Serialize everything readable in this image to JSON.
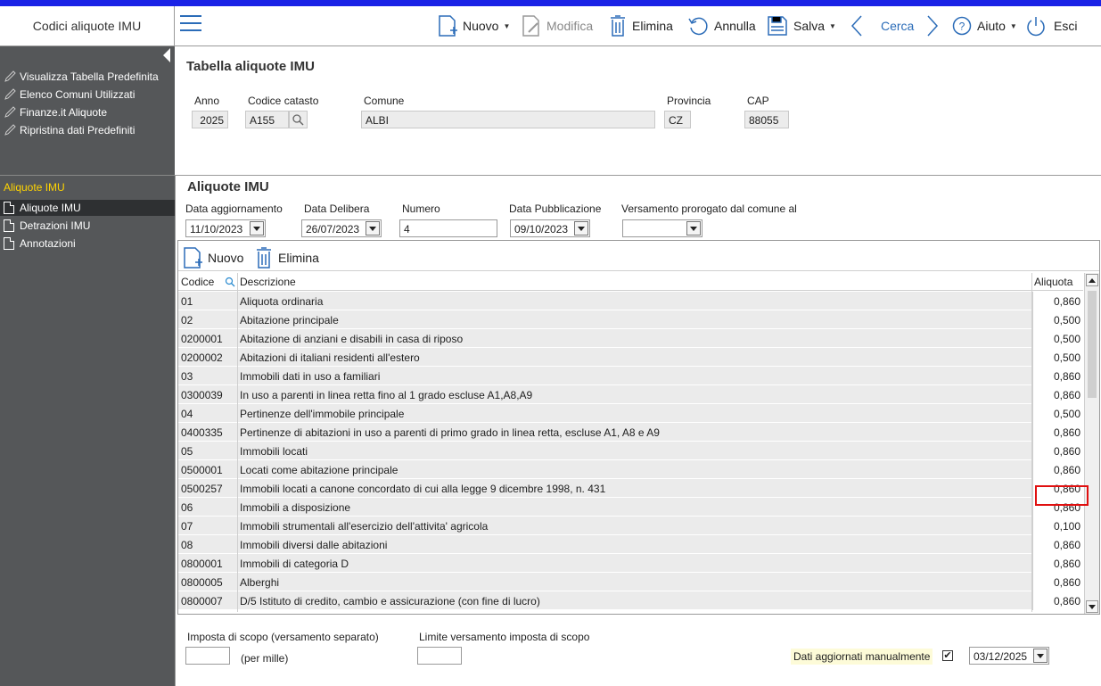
{
  "app": {
    "title": "Codici aliquote IMU"
  },
  "toolbar": {
    "nuovo": "Nuovo",
    "modifica": "Modifica",
    "elimina": "Elimina",
    "annulla": "Annulla",
    "salva": "Salva",
    "cerca": "Cerca",
    "aiuto": "Aiuto",
    "esci": "Esci"
  },
  "sidebar": {
    "links": [
      "Visualizza Tabella Predefinita",
      "Elenco Comuni Utilizzati",
      "Finanze.it Aliquote",
      "Ripristina dati Predefiniti"
    ],
    "section": "Aliquote IMU",
    "items": [
      "Aliquote IMU",
      "Detrazioni IMU",
      "Annotazioni"
    ]
  },
  "header": {
    "title": "Tabella aliquote IMU",
    "anno_label": "Anno",
    "anno": "2025",
    "catasto_label": "Codice catasto",
    "catasto": "A155",
    "comune_label": "Comune",
    "comune": "ALBI",
    "provincia_label": "Provincia",
    "provincia": "CZ",
    "cap_label": "CAP",
    "cap": "88055"
  },
  "aliquote": {
    "title": "Aliquote IMU",
    "data_agg_label": "Data aggiornamento",
    "data_agg": "11/10/2023",
    "data_del_label": "Data Delibera",
    "data_del": "26/07/2023",
    "numero_label": "Numero",
    "numero": "4",
    "data_pub_label": "Data Pubblicazione",
    "data_pub": "09/10/2023",
    "vers_label": "Versamento prorogato dal comune al",
    "vers": ""
  },
  "grid": {
    "nuovo": "Nuovo",
    "elimina": "Elimina",
    "col_codice": "Codice",
    "col_descr": "Descrizione",
    "col_aliquota": "Aliquota",
    "rows": [
      {
        "codice": "01",
        "descr": "Aliquota ordinaria",
        "val": "0,860"
      },
      {
        "codice": "02",
        "descr": "Abitazione principale",
        "val": "0,500"
      },
      {
        "codice": "0200001",
        "descr": "Abitazione di anziani e disabili in casa di riposo",
        "val": "0,500"
      },
      {
        "codice": "0200002",
        "descr": "Abitazioni di italiani residenti all'estero",
        "val": "0,500"
      },
      {
        "codice": "03",
        "descr": "Immobili dati in uso a familiari",
        "val": "0,860"
      },
      {
        "codice": "0300039",
        "descr": "In uso a parenti in linea retta fino al 1 grado escluse A1,A8,A9",
        "val": "0,860"
      },
      {
        "codice": "04",
        "descr": "Pertinenze dell'immobile principale",
        "val": "0,500"
      },
      {
        "codice": "0400335",
        "descr": "Pertinenze di abitazioni in uso a parenti di primo grado in linea retta, escluse A1, A8 e A9",
        "val": "0,860"
      },
      {
        "codice": "05",
        "descr": "Immobili locati",
        "val": "0,860"
      },
      {
        "codice": "0500001",
        "descr": "Locati come abitazione principale",
        "val": "0,860"
      },
      {
        "codice": "0500257",
        "descr": "Immobili locati a canone concordato di cui alla legge 9 dicembre 1998, n. 431",
        "val": "0,860"
      },
      {
        "codice": "06",
        "descr": "Immobili a disposizione",
        "val": "0,860"
      },
      {
        "codice": "07",
        "descr": "Immobili strumentali all'esercizio dell'attivita' agricola",
        "val": "0,100"
      },
      {
        "codice": "08",
        "descr": "Immobili diversi dalle abitazioni",
        "val": "0,860"
      },
      {
        "codice": "0800001",
        "descr": "Immobili di categoria D",
        "val": "0,860"
      },
      {
        "codice": "0800005",
        "descr": "Alberghi",
        "val": "0,860"
      },
      {
        "codice": "0800007",
        "descr": "D/5 Istituto di credito, cambio e assicurazione (con fine di lucro)",
        "val": "0,860"
      }
    ]
  },
  "footer": {
    "imposta_label": "Imposta di scopo (versamento separato)",
    "per_mille": "(per mille)",
    "limite_label": "Limite versamento imposta di scopo",
    "manual_label": "Dati aggiornati manualmente",
    "manual_checked": "✔",
    "manual_date": "03/12/2025"
  }
}
